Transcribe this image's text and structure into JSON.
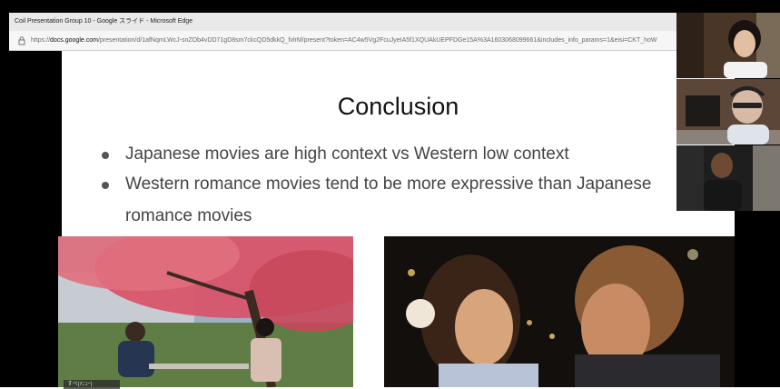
{
  "browser": {
    "window_title": "Coil Presentation Group 10 - Google スライド - Microsoft Edge",
    "url_prefix": "https://",
    "url_domain": "docs.google.com",
    "url_path": "/presentation/d/1afNqmLWcJ-snZOb4vDD71gD8sm7ckcQD5dkkQ_fvlrM/present?token=AC4w5Vg2FcuJyeIA5f1XQUAkUEPFDGe15A%3A1603068099661&includes_info_params=1&eisi=CKT_hoW"
  },
  "slide": {
    "title": "Conclusion",
    "bullets": [
      "Japanese movies are high context vs Western low context",
      "Western romance movies tend to be more expressive than Japanese",
      "romance movies"
    ]
  },
  "caption": "すべ(ﾒﾆｭｰ)",
  "colors": {
    "titlebar": "#e9e9e9",
    "slide_bg": "#ffffff",
    "letterbox": "#000000"
  }
}
